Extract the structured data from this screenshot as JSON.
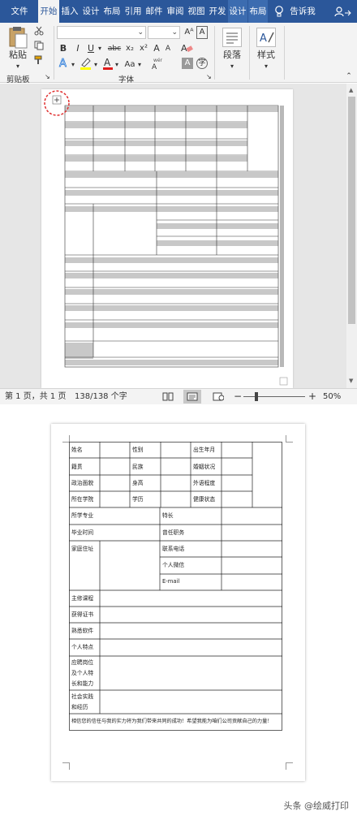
{
  "tabs": [
    "文件",
    "开始",
    "插入",
    "设计",
    "布局",
    "引用",
    "邮件",
    "审阅",
    "视图",
    "开发",
    "设计",
    "布局",
    "告诉我"
  ],
  "ribbon": {
    "paste": "粘贴",
    "clipboard": "剪贴板",
    "font_group": "字体",
    "paragraph": "段落",
    "styles": "样式",
    "bold": "B",
    "italic": "I",
    "underline": "U",
    "strike": "abc",
    "sub": "x₂",
    "sup": "x²",
    "font_a": "A",
    "case": "Aa",
    "grow": "A",
    "shrink": "A"
  },
  "status": {
    "page": "第 1 页，共 1 页",
    "words": "138/138 个字",
    "minus": "−",
    "plus": "+",
    "zoom": "50%"
  },
  "resume": {
    "r1": [
      "姓名",
      "性别",
      "出生年月"
    ],
    "r2": [
      "籍贯",
      "民族",
      "婚姻状况"
    ],
    "r3": [
      "政治面貌",
      "身高",
      "外语程度"
    ],
    "r4": [
      "所在学院",
      "学历",
      "健康状态"
    ],
    "major": "所学专业",
    "specialty": "特长",
    "graduation": "毕业时间",
    "position_held": "曾任职务",
    "address": "家庭住址",
    "phone": "联系电话",
    "wechat": "个人微信",
    "email": "E-mail",
    "courses": "主修课程",
    "certs": "获得证书",
    "software": "熟悉软件",
    "traits": "个人特点",
    "apply_1": "应聘岗位",
    "apply_2": "及个人特",
    "apply_3": "长和能力",
    "practice_1": "社会实践",
    "practice_2": "和经历",
    "closing": "相信您的信任与我的实力将为我们带来共同的成功！希望我能为咱们公司贡献自己的力量！"
  },
  "footer": "头条 @绘威打印"
}
